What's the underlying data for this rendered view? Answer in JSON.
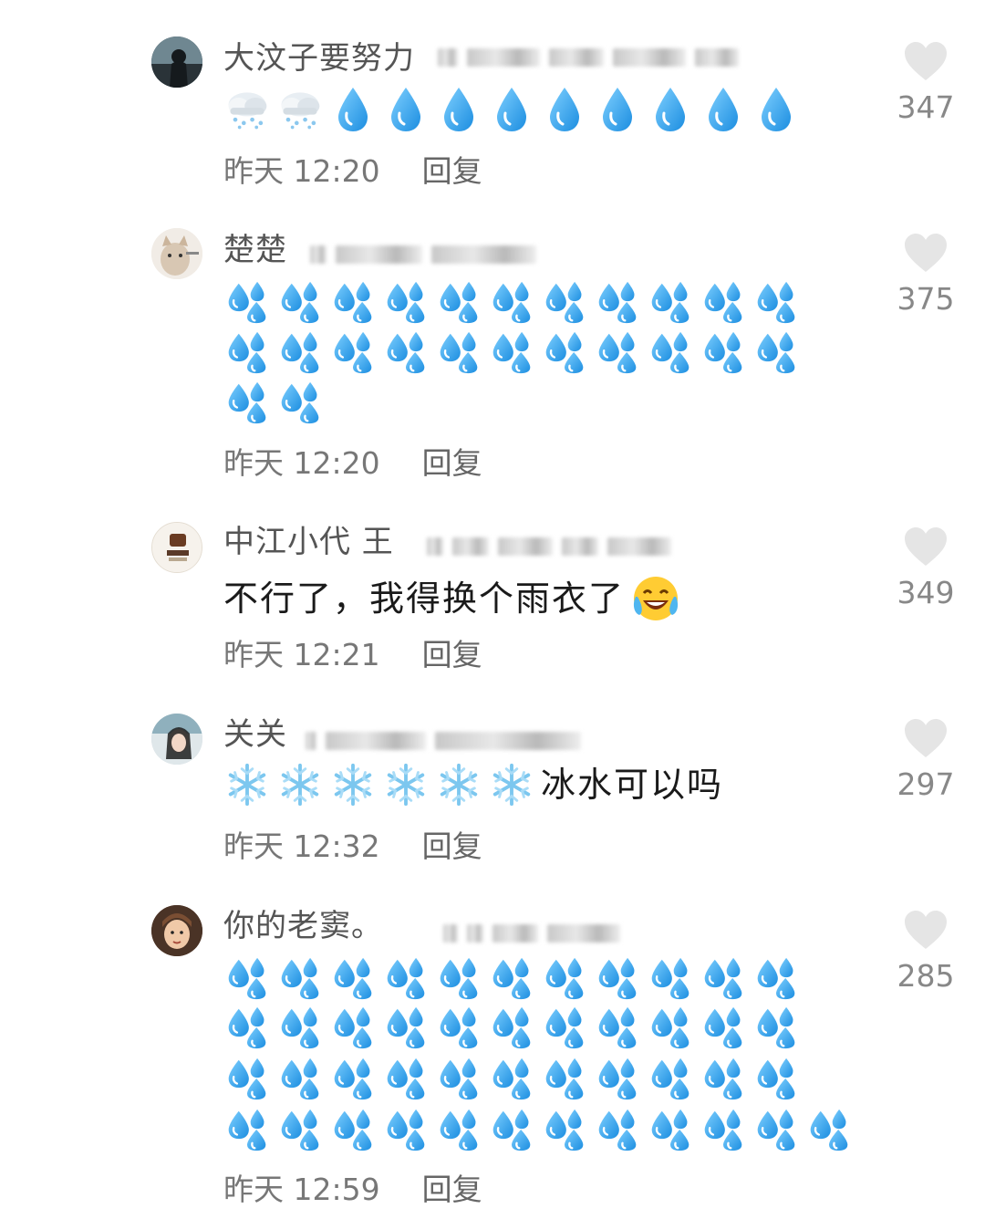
{
  "comments": [
    {
      "username": "大汶子要努力",
      "emoji_text": "🌨️🌨️💧💧💧💧💧💧💧💧💧",
      "time": "昨天 12:20",
      "reply_label": "回复",
      "likes": "347"
    },
    {
      "username": "楚楚",
      "emoji_text": "💦💦💦💦💦💦💦💦💦💦💦💦💦💦💦💦💦💦💦💦💦💦💦💦",
      "time": "昨天 12:20",
      "reply_label": "回复",
      "likes": "375"
    },
    {
      "username": "中江小代 王",
      "text": "不行了，我得换个雨衣了",
      "trailing_emoji": "😂",
      "time": "昨天 12:21",
      "reply_label": "回复",
      "likes": "349"
    },
    {
      "username": "关关",
      "emoji_text": "❄️❄️❄️❄️❄️❄️",
      "text": "冰水可以吗",
      "time": "昨天 12:32",
      "reply_label": "回复",
      "likes": "297"
    },
    {
      "username": "你的老窦。",
      "emoji_text": "💦💦💦💦💦💦💦💦💦💦💦💦💦💦💦💦💦💦💦💦💦💦💦💦💦💦💦💦💦💦💦💦💦💦💦💦💦💦💦💦💦💦💦💦💦💦💦",
      "time": "昨天 12:59",
      "reply_label": "回复",
      "likes": "285"
    }
  ],
  "colors": {
    "drop": "#2f9fe8",
    "like_icon": "#e6e6e6",
    "meta_text": "#777777"
  },
  "icons": {
    "like": "heart-icon",
    "drop": "droplet-icon",
    "sweat": "sweat-droplets-icon",
    "cloud": "cloud-rain-icon",
    "snow": "snowflake-icon",
    "laugh": "laughing-crying-icon"
  }
}
